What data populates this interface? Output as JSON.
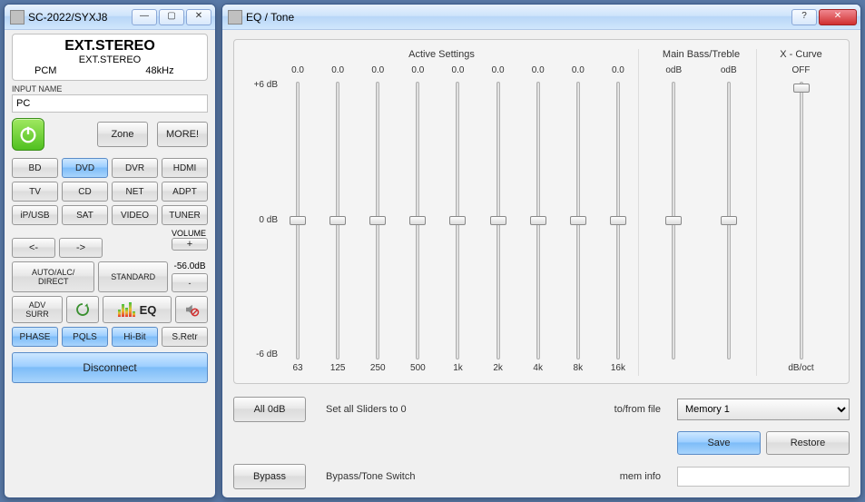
{
  "main": {
    "title": "SC-2022/SYXJ8",
    "ext_title": "EXT.STEREO",
    "ext_sub": "EXT.STEREO",
    "codec": "PCM",
    "rate": "48kHz",
    "input_name_label": "INPUT NAME",
    "input_name_value": "PC",
    "zone": "Zone",
    "more": "MORE!",
    "inputs": [
      "BD",
      "DVD",
      "DVR",
      "HDMI",
      "TV",
      "CD",
      "NET",
      "ADPT",
      "iP/USB",
      "SAT",
      "VIDEO",
      "TUNER"
    ],
    "arrow_left": "<-",
    "arrow_right": "->",
    "volume_label": "VOLUME",
    "vol_plus": "+",
    "vol_value": "-56.0dB",
    "vol_minus": "-",
    "auto": "AUTO/ALC/\nDIRECT",
    "standard": "STANDARD",
    "adv": "ADV\nSURR",
    "eq": "EQ",
    "phase": "PHASE",
    "pqls": "PQLS",
    "hibit": "Hi-Bit",
    "sretr": "S.Retr",
    "disconnect": "Disconnect"
  },
  "eq": {
    "title": "EQ / Tone",
    "active_title": "Active Settings",
    "bt_title": "Main Bass/Treble",
    "x_title": "X - Curve",
    "db_top": "+6 dB",
    "db_mid": "0 dB",
    "db_bot": "-6 dB",
    "bands": [
      {
        "v": "0.0",
        "f": "63"
      },
      {
        "v": "0.0",
        "f": "125"
      },
      {
        "v": "0.0",
        "f": "250"
      },
      {
        "v": "0.0",
        "f": "500"
      },
      {
        "v": "0.0",
        "f": "1k"
      },
      {
        "v": "0.0",
        "f": "2k"
      },
      {
        "v": "0.0",
        "f": "4k"
      },
      {
        "v": "0.0",
        "f": "8k"
      },
      {
        "v": "0.0",
        "f": "16k"
      }
    ],
    "bass": "odB",
    "treble": "odB",
    "xcurve": "OFF",
    "xunit": "dB/oct",
    "all0": "All 0dB",
    "all0_lbl": "Set all Sliders to 0",
    "tofrom": "to/from file",
    "bypass": "Bypass",
    "bypass_lbl": "Bypass/Tone Switch",
    "meminfo": "mem info",
    "memsel": "Memory 1",
    "save": "Save",
    "restore": "Restore"
  }
}
